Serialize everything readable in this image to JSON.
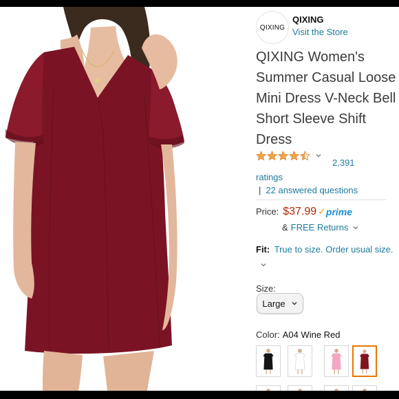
{
  "store": {
    "logo_text": "QIXING",
    "brand_name": "QIXING",
    "visit_link": "Visit the Store"
  },
  "product": {
    "title": "QIXING Women's Summer Casual Loose Mini Dress V-Neck Bell Short Sleeve Shift Dress",
    "rating_stars": 4.5,
    "rating_count": "2,391",
    "ratings_label": "ratings",
    "questions_separator": "|",
    "answered_questions": "22 answered questions"
  },
  "price": {
    "label": "Price:",
    "value": "$37.99",
    "prime_check": "✓",
    "prime_label": "prime",
    "returns_prefix": "&",
    "returns_link": "FREE Returns"
  },
  "fit": {
    "label": "Fit:",
    "text": "True to size. Order usual size."
  },
  "size": {
    "label": "Size:",
    "selected": "Large"
  },
  "color": {
    "label": "Color:",
    "value": "A04 Wine Red",
    "swatches": [
      "#151515",
      "#ffffff",
      "#f4a6c4",
      "#7e1420",
      "#1c2a52",
      "#2b3f8f",
      "#1e5a2d",
      "#9cc7e0"
    ]
  },
  "colors": {
    "link": "#1d7b9b",
    "price": "#b12704",
    "star": "#f3a847",
    "prime_blue": "#1d8fd6",
    "selected_border": "#e77600",
    "dress": "#7a1424"
  },
  "icons": {
    "rating_chevron": "chevron-down-icon",
    "returns_chevron": "chevron-down-icon",
    "fit_chevron": "chevron-down-icon",
    "size_chevron": "chevron-down-icon",
    "star": "star-icon"
  }
}
